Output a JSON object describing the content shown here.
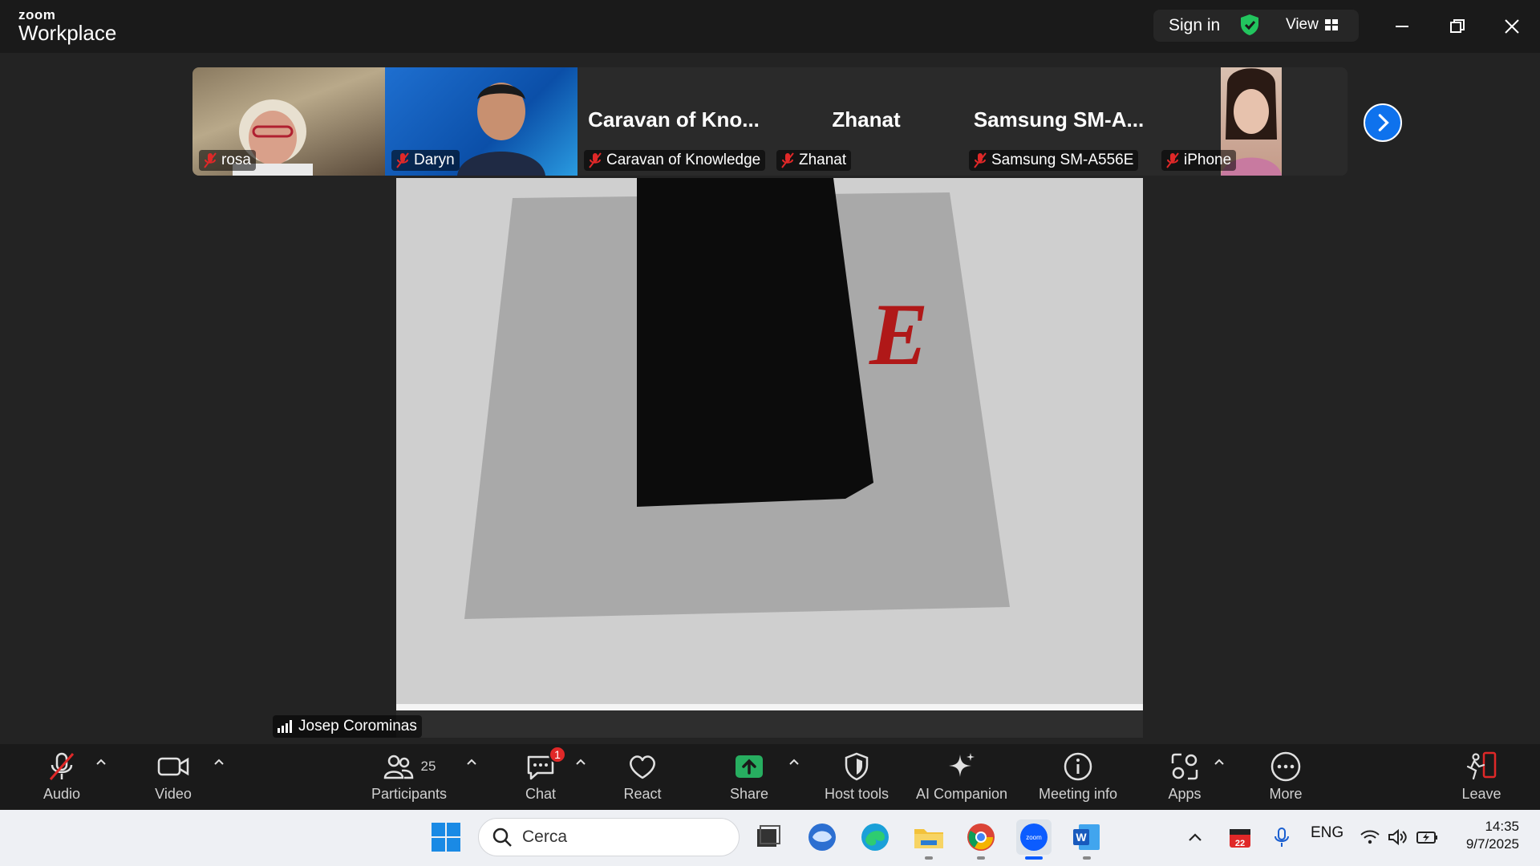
{
  "app": {
    "brand_top": "zoom",
    "brand_bottom": "Workplace"
  },
  "titlebar": {
    "sign_in": "Sign in",
    "view": "View"
  },
  "gallery": {
    "tiles": [
      {
        "name": "rosa",
        "big_label": ""
      },
      {
        "name": "Daryn",
        "big_label": ""
      },
      {
        "name": "Caravan of Knowledge",
        "big_label": "Caravan of Kno..."
      },
      {
        "name": "Zhanat",
        "big_label": "Zhanat"
      },
      {
        "name": "Samsung SM-A556E",
        "big_label": "Samsung SM-A..."
      },
      {
        "name": "iPhone",
        "big_label": ""
      }
    ]
  },
  "main_video": {
    "speaker": "Josep Corominas",
    "paper_letter": "E"
  },
  "toolbar": {
    "audio": "Audio",
    "video": "Video",
    "participants": "Participants",
    "participants_count": "25",
    "chat": "Chat",
    "chat_badge": "1",
    "react": "React",
    "share": "Share",
    "host_tools": "Host tools",
    "ai_companion": "AI Companion",
    "meeting_info": "Meeting info",
    "apps": "Apps",
    "more": "More",
    "leave": "Leave"
  },
  "taskbar": {
    "search_placeholder": "Cerca",
    "lang": "ENG",
    "calendar_day": "22",
    "time": "14:35",
    "date": "9/7/2025"
  },
  "colors": {
    "accent_blue": "#0e72ed",
    "share_green": "#27ae60",
    "mute_red": "#e02828",
    "shield_green": "#22c55e"
  }
}
